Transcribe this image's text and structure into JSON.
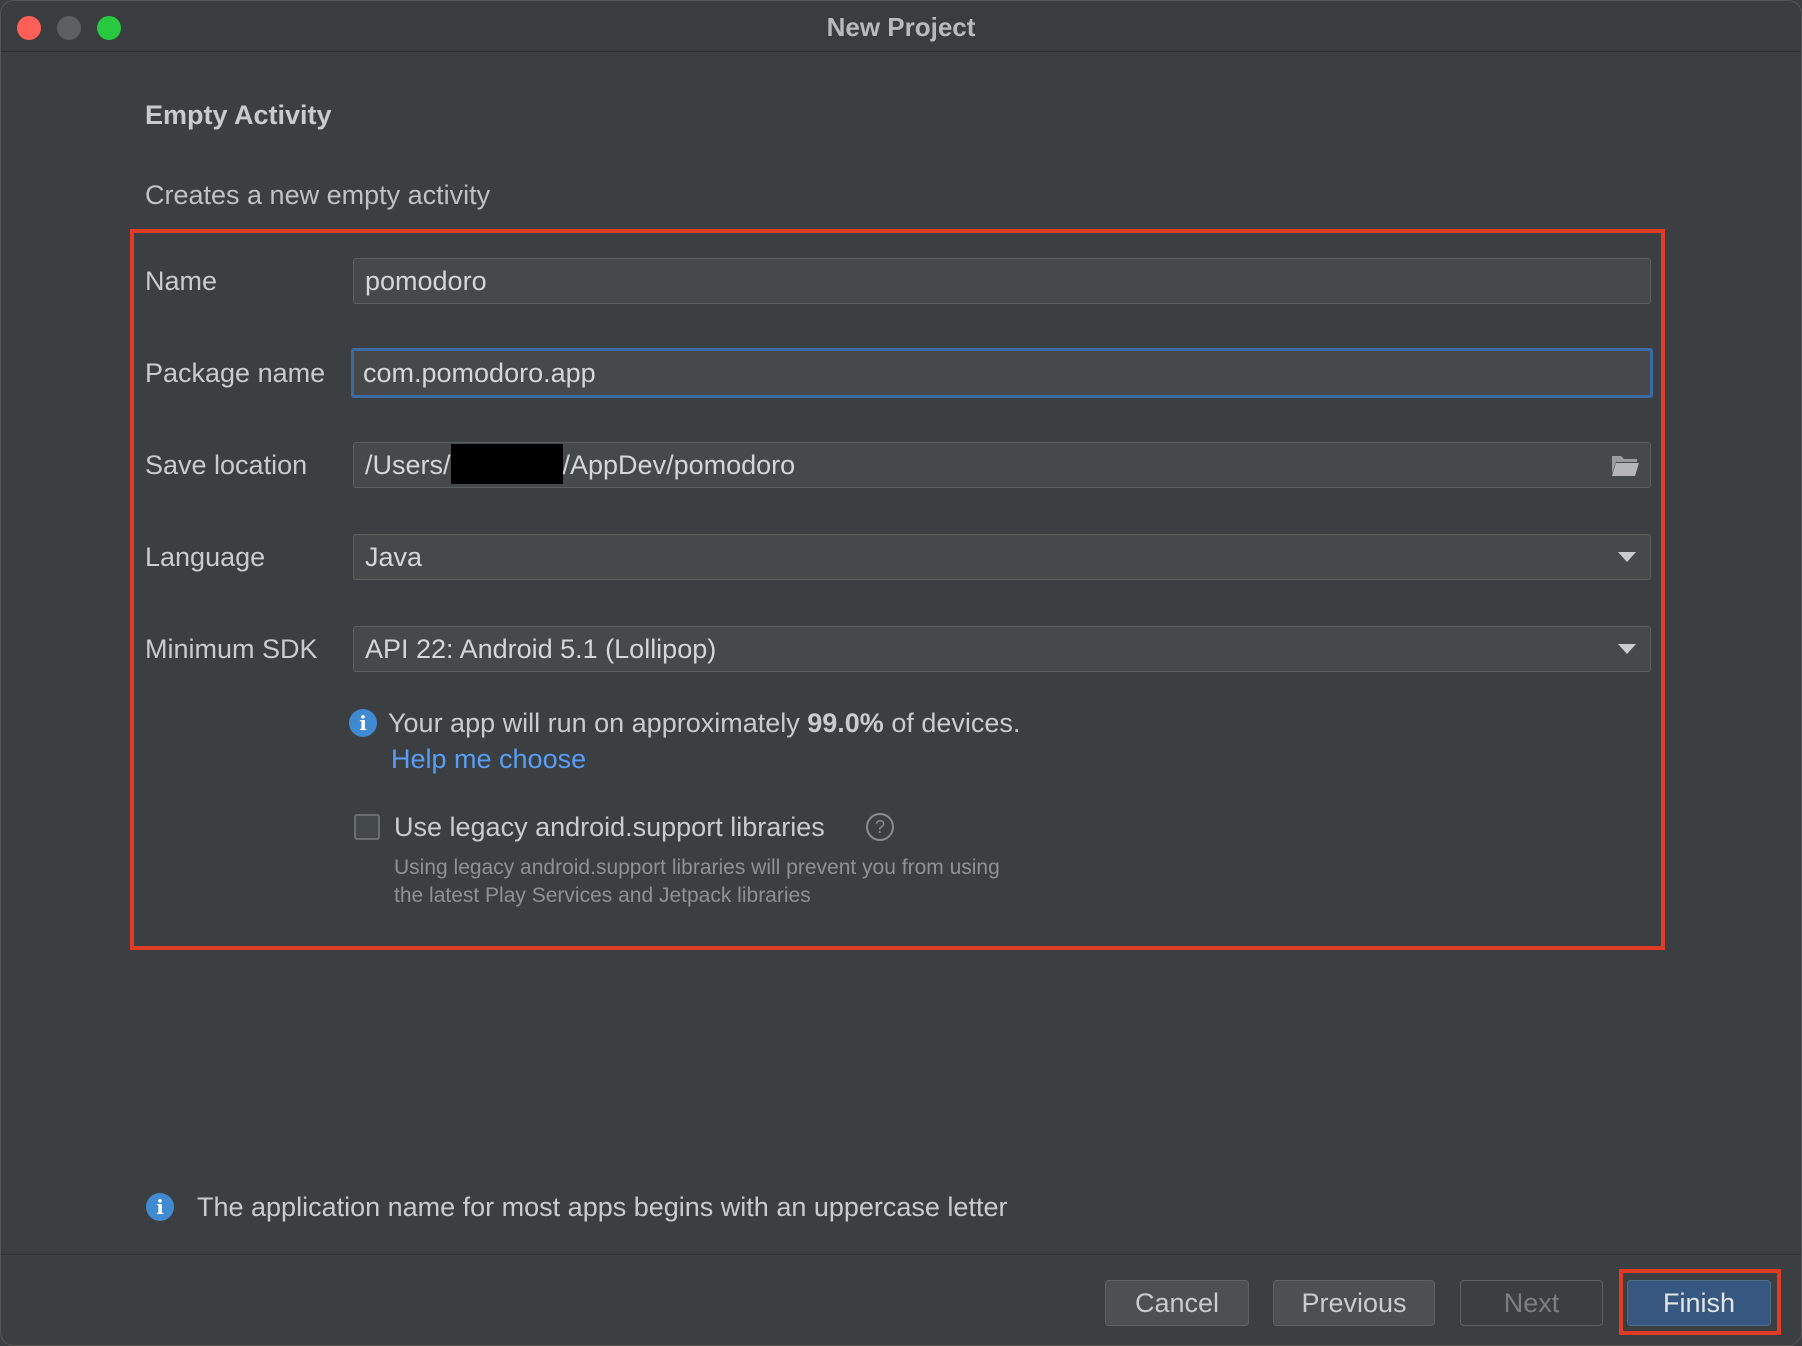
{
  "window": {
    "title": "New Project"
  },
  "header": {
    "heading": "Empty Activity",
    "subheading": "Creates a new empty activity"
  },
  "form": {
    "name": {
      "label": "Name",
      "value": "pomodoro"
    },
    "package": {
      "label": "Package name",
      "value": "com.pomodoro.app"
    },
    "save_location": {
      "label": "Save location",
      "value_prefix": "/Users/",
      "value_suffix": "/AppDev/pomodoro",
      "icon": "folder-icon"
    },
    "language": {
      "label": "Language",
      "selected": "Java"
    },
    "min_sdk": {
      "label": "Minimum SDK",
      "selected": "API 22: Android 5.1 (Lollipop)"
    },
    "coverage": {
      "text_before": "Your app will run on approximately ",
      "percent": "99.0%",
      "text_after": " of devices.",
      "link": "Help me choose"
    },
    "legacy": {
      "checked": false,
      "label": "Use legacy android.support libraries",
      "hint_line1": "Using legacy android.support libraries will prevent you from using",
      "hint_line2": "the latest Play Services and Jetpack libraries"
    }
  },
  "footer_info": "The application name for most apps begins with an uppercase letter",
  "buttons": {
    "cancel": "Cancel",
    "previous": "Previous",
    "next": "Next",
    "finish": "Finish"
  },
  "colors": {
    "highlight": "#e03c25",
    "accent": "#365880",
    "link": "#589df6",
    "info": "#3f8ad0"
  }
}
